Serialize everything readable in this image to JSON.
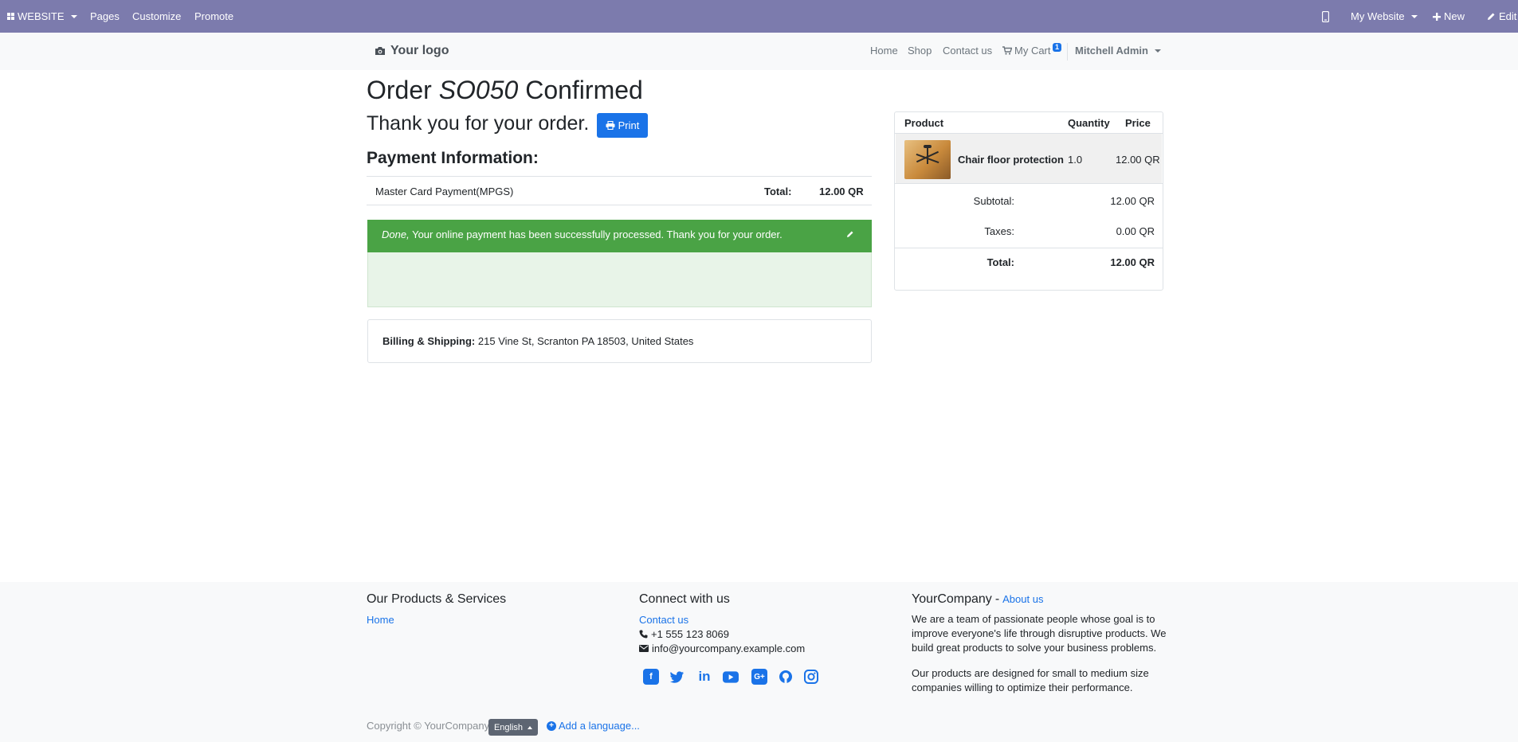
{
  "adminbar": {
    "website_menu": "WEBSITE",
    "pages": "Pages",
    "customize": "Customize",
    "promote": "Promote",
    "my_website": "My Website",
    "new": "New",
    "edit": "Edit",
    "bg_color": "#7c7bad"
  },
  "header": {
    "logo": "Your logo",
    "nav": [
      "Home",
      "Shop",
      "Contact us"
    ],
    "cart": "My Cart",
    "cart_count": "1",
    "user": "Mitchell Admin"
  },
  "order": {
    "prefix": "Order",
    "number": "SO050",
    "suffix": "Confirmed",
    "thanks": "Thank you for your order.",
    "print_label": "Print",
    "payment_heading": "Payment Information:",
    "payment_method": "Master Card Payment(MPGS)",
    "total_label": "Total:",
    "total_value": "12.00 QR",
    "alert_status": "Done,",
    "alert_message": "Your online payment has been successfully processed. Thank you for your order.",
    "billing_label": "Billing & Shipping:",
    "billing_address": "215 Vine St, Scranton PA 18503, United States"
  },
  "summary": {
    "col_product": "Product",
    "col_quantity": "Quantity",
    "col_price": "Price",
    "product_name": "Chair floor protection",
    "product_qty": "1.0",
    "product_price": "12.00 QR",
    "subtotal_label": "Subtotal:",
    "subtotal_value": "12.00 QR",
    "taxes_label": "Taxes:",
    "taxes_value": "0.00 QR",
    "total_label": "Total:",
    "total_value": "12.00 QR"
  },
  "footer": {
    "products_heading": "Our Products & Services",
    "products_link": "Home",
    "connect_heading": "Connect with us",
    "contact_link": "Contact us",
    "phone": "+1 555 123 8069",
    "email": "info@yourcompany.example.com",
    "company_name": "YourCompany",
    "about_sep": "-",
    "about_link": "About us",
    "about_p1": "We are a team of passionate people whose goal is to improve everyone's life through disruptive products. We build great products to solve your business problems.",
    "about_p2": "Our products are designed for small to medium size companies willing to optimize their performance.",
    "social_icons": [
      "facebook-icon",
      "twitter-icon",
      "linkedin-icon",
      "youtube-icon",
      "google-plus-icon",
      "github-icon",
      "instagram-icon"
    ],
    "copyright": "Copyright © YourCompany",
    "language": "English",
    "add_language": "Add a language..."
  }
}
